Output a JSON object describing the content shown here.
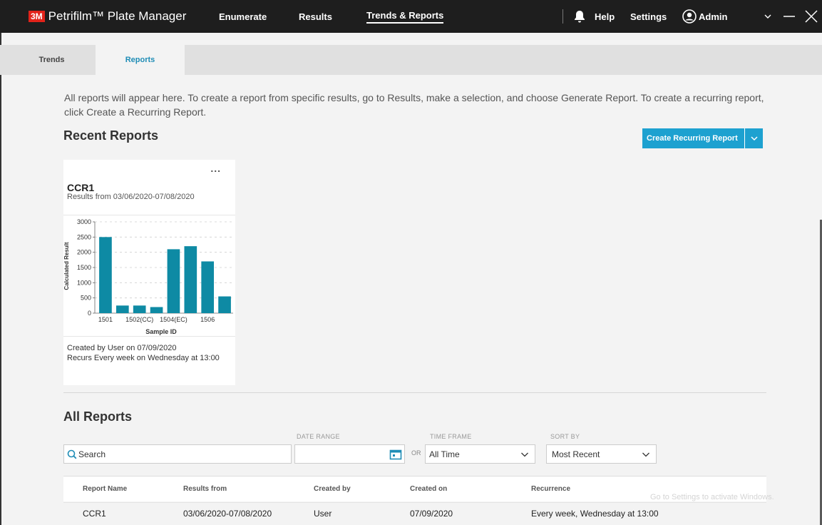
{
  "app": {
    "logo": "3M",
    "title": "Petrifilm™ Plate Manager"
  },
  "nav": {
    "enumerate": "Enumerate",
    "results": "Results",
    "trends_reports": "Trends & Reports"
  },
  "header_right": {
    "help": "Help",
    "settings": "Settings",
    "user": "Admin"
  },
  "tabs": {
    "trends": "Trends",
    "reports": "Reports"
  },
  "intro": "All reports will appear here. To create a report from specific results, go to Results, make a selection, and choose Generate Report. To create a recurring report, click Create a Recurring Report.",
  "recent": {
    "heading": "Recent Reports",
    "create_button": "Create Recurring Report",
    "card": {
      "menu": "...",
      "name": "CCR1",
      "range": "Results from 03/06/2020-07/08/2020",
      "created": "Created by User on 07/09/2020",
      "recurs": "Recurs Every week on Wednesday at 13:00"
    }
  },
  "chart_data": {
    "type": "bar",
    "categories": [
      "1501",
      "",
      "1502(CC)",
      "",
      "1504(EC)",
      "",
      "1506",
      ""
    ],
    "values": [
      2500,
      250,
      250,
      200,
      2100,
      2200,
      1700,
      550
    ],
    "ylabel": "Calculated Result",
    "xlabel": "Sample ID",
    "ylim": [
      0,
      3000
    ],
    "yticks": [
      "0",
      "500",
      "1000",
      "1500",
      "2000",
      "2500",
      "3000"
    ],
    "grid": true,
    "color": "#0e8aa4"
  },
  "all": {
    "heading": "All Reports",
    "search_placeholder": "Search",
    "date_range_label": "DATE RANGE",
    "or_label": "OR",
    "time_frame_label": "TIME FRAME",
    "time_frame_value": "All Time",
    "sort_label": "SORT BY",
    "sort_value": "Most Recent",
    "columns": [
      "Report Name",
      "Results from",
      "Created by",
      "Created on",
      "Recurrence"
    ],
    "rows": [
      [
        "CCR1",
        "03/06/2020-07/08/2020",
        "User",
        "07/09/2020",
        "Every week, Wednesday at 13:00"
      ]
    ]
  },
  "watermark": "Go to Settings to activate Windows.",
  "colors": {
    "accent": "#1da1d0",
    "titlebar": "#1e1e1e",
    "brand_red": "#e2231a"
  }
}
